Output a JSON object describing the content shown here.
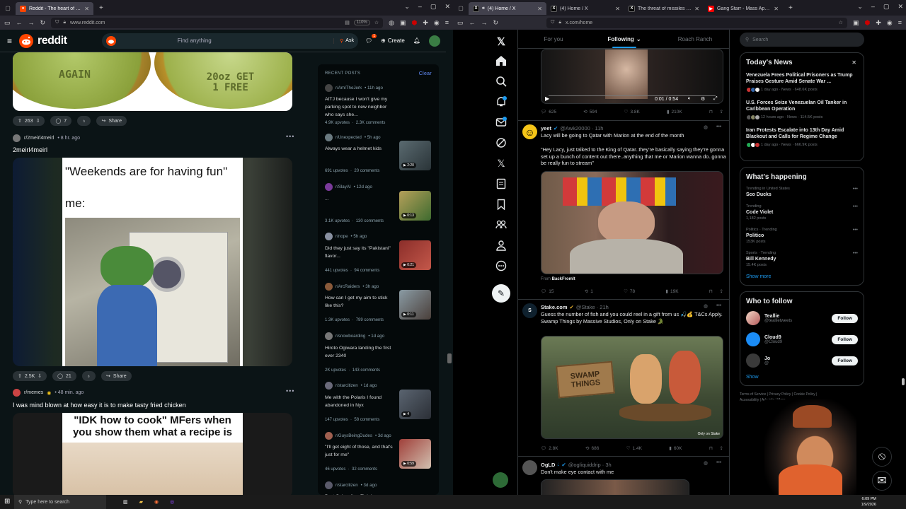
{
  "reddit": {
    "tab_title": "Reddit - The heart of the internet",
    "url": "www.reddit.com",
    "zoom": "110%",
    "logo_text": "reddit",
    "search_placeholder": "Find anything",
    "ask_label": "Ask",
    "create_label": "Create",
    "post1": {
      "upvotes": "263",
      "comments": "7",
      "share_label": "Share",
      "cap_left": "AGAIN",
      "cap_right": "20oz GET\n1 FREE"
    },
    "post2": {
      "subreddit": "r/2meirl4meirl",
      "time": "• 8 hr. ago",
      "title": "2meirl4meirl",
      "meme_top": "\"Weekends are for having fun\"",
      "meme_me": "me:",
      "upvotes": "2.5K",
      "comments": "21",
      "share_label": "Share"
    },
    "post3": {
      "subreddit": "r/memes",
      "time": "• 48 min. ago",
      "title": "I was mind blown at how easy it is to make tasty fried chicken",
      "meme_text": "\"IDK how to cook\" MFers when you show them what a recipe is"
    },
    "recent": {
      "header": "RECENT POSTS",
      "clear_label": "Clear",
      "items": [
        {
          "sub": "r/AmITheJerk",
          "time": "• 11h ago",
          "title": "AITJ because I won't give my parking spot to new neighbor who says she...",
          "upvotes": "4.9K upvotes",
          "comments": "2.3K comments",
          "badge": ""
        },
        {
          "sub": "r/Unexpected",
          "time": "• 5h ago",
          "title": "Always wear a helmet kids",
          "upvotes": "691 upvotes",
          "comments": "20 comments",
          "badge": "2:20"
        },
        {
          "sub": "r/SlayAI",
          "time": "• 12d ago",
          "title": "...",
          "upvotes": "3.1K upvotes",
          "comments": "130 comments",
          "badge": "0:13"
        },
        {
          "sub": "r/nope",
          "time": "• 5h ago",
          "title": "Did they just say its \"Pakistani\" flavor...",
          "upvotes": "441 upvotes",
          "comments": "94 comments",
          "badge": "0:21"
        },
        {
          "sub": "r/ArcRaiders",
          "time": "• 3h ago",
          "title": "How can I get my aim to stick like this?",
          "upvotes": "1.3K upvotes",
          "comments": "799 comments",
          "badge": "0:11"
        },
        {
          "sub": "r/snowboarding",
          "time": "• 1d ago",
          "title": "Hiroto Ogiwara landing the first ever 2340",
          "upvotes": "2K upvotes",
          "comments": "143 comments",
          "badge": ""
        },
        {
          "sub": "r/starcitizen",
          "time": "• 1d ago",
          "title": "Me with the Polaris I found abandoned in Nyx",
          "upvotes": "147 upvotes",
          "comments": "58 comments",
          "badge": "4"
        },
        {
          "sub": "r/GuysBeingDudes",
          "time": "• 3d ago",
          "title": "\"I'll get eight of those, and that's just for me\"",
          "upvotes": "46 upvotes",
          "comments": "32 comments",
          "badge": "0:59"
        },
        {
          "sub": "r/starcitizen",
          "time": "• 3d ago",
          "title": "Best Subscriber Flair in",
          "upvotes": "",
          "comments": "",
          "badge": ""
        }
      ]
    }
  },
  "x": {
    "tabs": [
      {
        "title": "(4) Home / X"
      },
      {
        "title": "(4) Home / X"
      },
      {
        "title": "The threat of missiles and"
      },
      {
        "title": "Gang Starr - Mass Appeal - You"
      }
    ],
    "url": "x.com/home",
    "feed_tabs": [
      "For you",
      "Following",
      "Roach Ranch"
    ],
    "video_time": "0:01 / 0:54",
    "tweet0_actions": {
      "replies": "625",
      "reposts": "594",
      "likes": "3.8K",
      "views": "210K"
    },
    "tweet1": {
      "name": "yeet",
      "handle": "@Awk20000 · 11h",
      "text1": "Lacy will be going to Qatar with Marion at the end of the month",
      "text2": "\"Hey Lacy, just talked to the King of Qatar..they're basically saying they're gonna set up a bunch of content out there..anything that me or Marion wanna do..gonna be really fun to stream\"",
      "from_prefix": "From",
      "from_source": "BackFromIt",
      "replies": "15",
      "reposts": "1",
      "likes": "78",
      "views": "19K"
    },
    "tweet2": {
      "name": "Stake.com",
      "handle": "@Stake · 21h",
      "text": "Guess the number of fish and you could reel in a gift from us 🎣💰 T&Cs Apply.\nSwamp Things by Massive Studios, Only on Stake 🐊",
      "sign": "SWAMP\nTHINGS",
      "watermark": "Only on Stake",
      "replies": "2.8K",
      "reposts": "686",
      "likes": "1.4K",
      "views": "60K"
    },
    "tweet3": {
      "name": "OgLD",
      "handle": "@ogliquiddrip · 3h",
      "text": "Don't make eye contact with me"
    },
    "search_placeholder": "Search",
    "news": {
      "title": "Today's News",
      "items": [
        {
          "title": "Venezuela Frees Political Prisoners as Trump Praises Gesture Amid Senate War ...",
          "meta": "1 day ago · News · 648.6K posts"
        },
        {
          "title": "U.S. Forces Seize Venezuelan Oil Tanker in Caribbean Operation",
          "meta": "12 hours ago · News · 114.5K posts"
        },
        {
          "title": "Iran Protests Escalate into 13th Day Amid Blackout and Calls for Regime Change",
          "meta": "1 day ago · News · 666.9K posts"
        }
      ]
    },
    "happening": {
      "title": "What's happening",
      "items": [
        {
          "context": "Trending in United States",
          "name": "Sco Ducks",
          "posts": ""
        },
        {
          "context": "Trending",
          "name": "Code Violet",
          "posts": "1,182 posts"
        },
        {
          "context": "Politics · Trending",
          "name": "Politico",
          "posts": "153K posts"
        },
        {
          "context": "Sports · Trending",
          "name": "Bill Kennedy",
          "posts": "15.4K posts"
        }
      ],
      "show_more": "Show more"
    },
    "follow": {
      "title": "Who to follow",
      "items": [
        {
          "name": "Teallie",
          "handle": "@teallietweets",
          "btn": "Follow"
        },
        {
          "name": "Cloud9",
          "handle": "@Cloud9",
          "btn": "Follow"
        },
        {
          "name": "Jo",
          "handle": "@",
          "btn": "Follow"
        }
      ],
      "show_more": "Show"
    },
    "footer": "Terms of Service | Privacy Policy | Cookie Policy |\nAccessibility | Ads info | More ..."
  },
  "taskbar": {
    "search_placeholder": "Type here to search",
    "time": "6:09 PM",
    "date": "1/9/2026"
  }
}
